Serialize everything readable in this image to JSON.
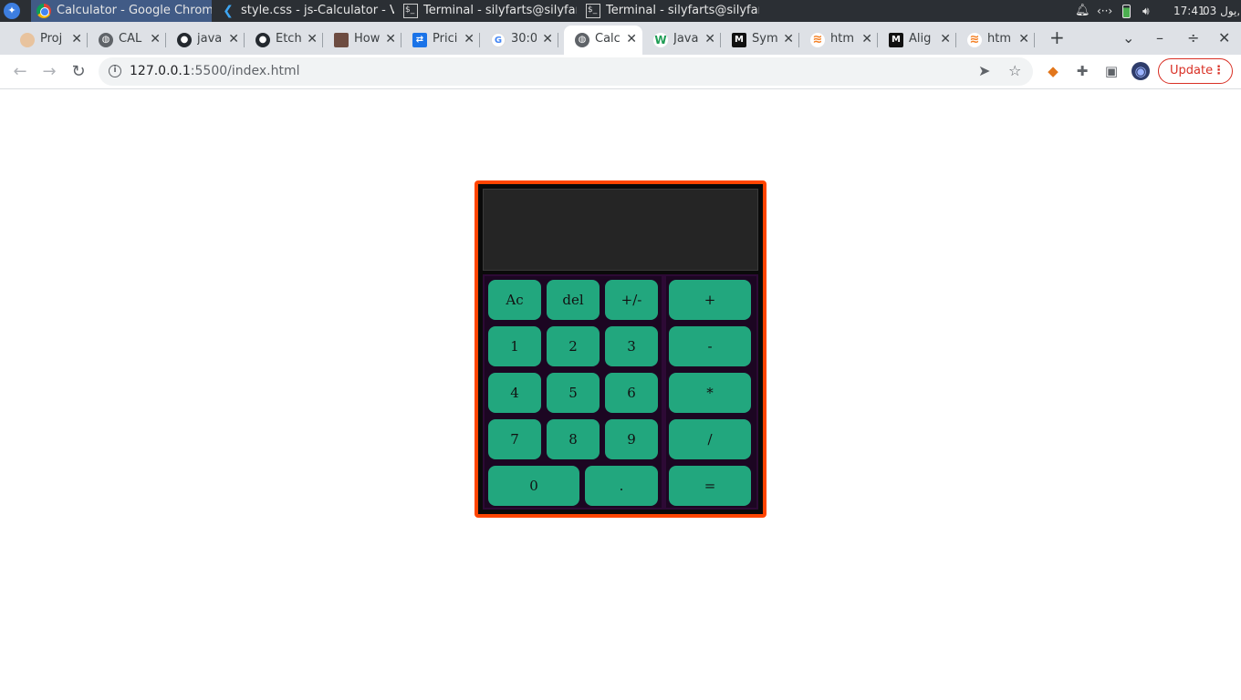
{
  "taskbar": {
    "tasks": [
      {
        "title": "Calculator - Google Chrome",
        "icon": "chrome-icon"
      },
      {
        "title": "style.css - js-Calculator - Vis...",
        "icon": "vscode-icon"
      },
      {
        "title": "Terminal - silyfarts@silyfart...",
        "icon": "terminal-icon"
      },
      {
        "title": "Terminal - silyfarts@silyfart...",
        "icon": "terminal-icon"
      }
    ],
    "time": "17:41",
    "date": "03 يول,"
  },
  "tabs": [
    {
      "label": "Proj",
      "color": "#e8c39e"
    },
    {
      "label": "CAL",
      "color": "#5f6368"
    },
    {
      "label": "java",
      "color": "#24292f"
    },
    {
      "label": "Etch",
      "color": "#24292f"
    },
    {
      "label": "How",
      "color": "#6d4c41"
    },
    {
      "label": "Prici",
      "color": "#1a73e8"
    },
    {
      "label": "30:0",
      "color": "#4285f4"
    },
    {
      "label": "Calc",
      "color": "#5f6368"
    },
    {
      "label": "Java",
      "color": "#1f9d55"
    },
    {
      "label": "Sym",
      "color": "#111111"
    },
    {
      "label": "htm",
      "color": "#f48024"
    },
    {
      "label": "Alig",
      "color": "#111111"
    },
    {
      "label": "htm",
      "color": "#f48024"
    }
  ],
  "toolbar": {
    "url_host": "127.0.0.1",
    "url_rest": ":5500/index.html",
    "update_label": "Update"
  },
  "calculator": {
    "display_value": "",
    "keys": {
      "ac": "Ac",
      "del": "del",
      "sign": "+/-",
      "add": "+",
      "one": "1",
      "two": "2",
      "three": "3",
      "subtract": "-",
      "four": "4",
      "five": "5",
      "six": "6",
      "multiply": "*",
      "seven": "7",
      "eight": "8",
      "nine": "9",
      "divide": "/",
      "zero": "0",
      "decimal": ".",
      "equals": "="
    }
  }
}
